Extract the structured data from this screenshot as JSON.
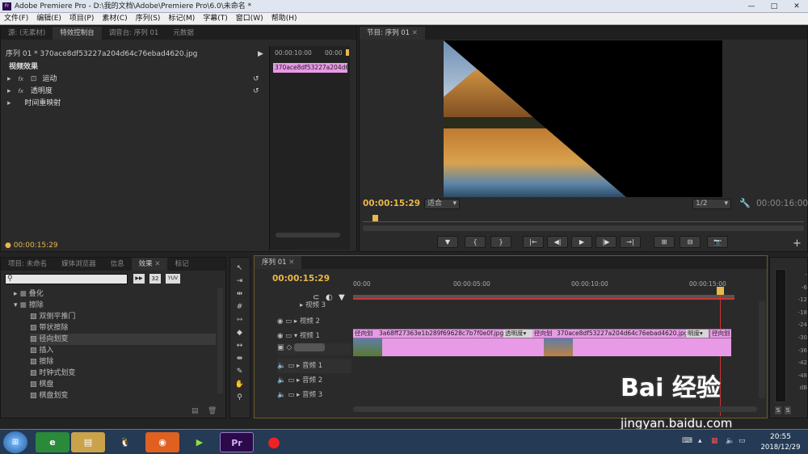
{
  "window": {
    "title": "Adobe Premiere Pro - D:\\我的文档\\Adobe\\Premiere Pro\\6.0\\未命名 *",
    "min": "—",
    "max": "□",
    "close": "✕"
  },
  "menu": [
    "文件(F)",
    "编辑(E)",
    "项目(P)",
    "素材(C)",
    "序列(S)",
    "标记(M)",
    "字幕(T)",
    "窗口(W)",
    "帮助(H)"
  ],
  "source_panel": {
    "tabs": [
      "源: (无素材)",
      "特效控制台",
      "调音台: 序列 01",
      "元数据"
    ],
    "sequence_path": "序列 01 * 370ace8df53227a204d64c76ebad4620.jpg",
    "time_a": "00:00:10:00",
    "time_b": "00:00",
    "clip_label": "370ace8df53227a204d64c76ebad4620.jpg",
    "section": "视频效果",
    "effects": [
      "运动",
      "透明度",
      "时间重映射"
    ],
    "timecode": "00:00:15:29"
  },
  "program": {
    "tab": "节目: 序列 01",
    "timecode": "00:00:15:29",
    "fit": "适合",
    "ratio": "1/2",
    "duration": "00:00:16:00",
    "controls": [
      "▼",
      "{",
      "}",
      "|←",
      "◀|",
      "▶",
      "|▶",
      "→|",
      "⊞",
      "⊟",
      "📷"
    ],
    "add": "+"
  },
  "project": {
    "tabs": [
      "项目: 未命名",
      "媒体浏览器",
      "信息",
      "效果",
      "标记"
    ],
    "search_placeholder": "",
    "badges": [
      "▶▶",
      "32",
      "YUV"
    ],
    "folders": [
      "叠化",
      "擦除"
    ],
    "items": [
      "双侧平推门",
      "带状擦除",
      "径向划变",
      "插入",
      "擦除",
      "时钟式划变",
      "棋盘",
      "棋盘划变"
    ]
  },
  "timeline": {
    "tab": "序列 01",
    "timecode": "00:00:15:29",
    "ruler": [
      "00:00",
      "00:00:05:00",
      "00:00:10:00",
      "00:00:15:00"
    ],
    "tracks": {
      "v3": "视频 3",
      "v2": "视频 2",
      "v1": "视频 1",
      "a1": "音频 1",
      "a2": "音频 2",
      "a3": "音频 3"
    },
    "clips": [
      "径向划",
      "3a68ff27363e1b289f69628c7b7f0e0f.jpg",
      "透明度",
      "径向划",
      "370ace8df53227a204d64c76ebad4620.jpg",
      "明度",
      "径向划"
    ]
  },
  "meter": {
    "scale": [
      "-",
      "-6",
      "-12",
      "-18",
      "-24",
      "-30",
      "-36",
      "-42",
      "-48",
      "dB"
    ],
    "solo": [
      "S",
      "S"
    ]
  },
  "taskbar": {
    "time": "20:55",
    "date": "2018/12/29"
  },
  "watermark": {
    "logo": "Bai 经验",
    "url": "jingyan.baidu.com"
  }
}
